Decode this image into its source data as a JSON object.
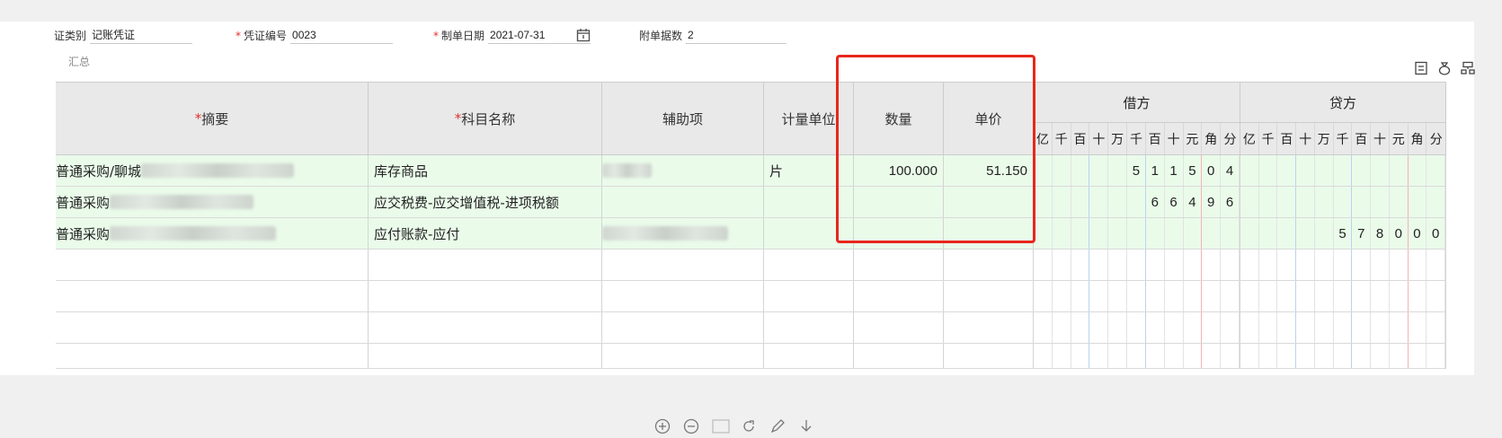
{
  "header": {
    "voucher_type_label": "证类别",
    "voucher_type_value": "记账凭证",
    "voucher_no_label": "凭证编号",
    "voucher_no_value": "0023",
    "date_label": "制单日期",
    "date_value": "2021-07-31",
    "attachments_label": "附单据数",
    "attachments_value": "2",
    "required_mark": "*"
  },
  "summary_label": "汇总",
  "columns": {
    "summary": "摘要",
    "account": "科目名称",
    "auxiliary": "辅助项",
    "unit": "计量单位",
    "quantity": "数量",
    "unit_price": "单价",
    "debit": "借方",
    "credit": "贷方",
    "digit_places": [
      "亿",
      "千",
      "百",
      "十",
      "万",
      "千",
      "百",
      "十",
      "元",
      "角",
      "分"
    ]
  },
  "rows": [
    {
      "summary": "普通采购/聊城",
      "account": "库存商品",
      "unit": "片",
      "quantity": "100.000",
      "unit_price": "51.150",
      "debit_digits": [
        "",
        "",
        "",
        "",
        "",
        "5",
        "1",
        "1",
        "5",
        "0",
        "4"
      ],
      "credit_digits": [
        "",
        "",
        "",
        "",
        "",
        "",
        "",
        "",
        "",
        "",
        ""
      ]
    },
    {
      "summary": "普通采购",
      "account": "应交税费-应交增值税-进项税额",
      "unit": "",
      "quantity": "",
      "unit_price": "",
      "debit_digits": [
        "",
        "",
        "",
        "",
        "",
        "",
        "6",
        "6",
        "4",
        "9",
        "6"
      ],
      "credit_digits": [
        "",
        "",
        "",
        "",
        "",
        "",
        "",
        "",
        "",
        "",
        ""
      ]
    },
    {
      "summary": "普通采购",
      "account": "应付账款-应付",
      "unit": "",
      "quantity": "",
      "unit_price": "",
      "debit_digits": [
        "",
        "",
        "",
        "",
        "",
        "",
        "",
        "",
        "",
        "",
        ""
      ],
      "credit_digits": [
        "",
        "",
        "",
        "",
        "",
        "5",
        "7",
        "8",
        "0",
        "0",
        "0"
      ]
    }
  ],
  "empty_rows": 4,
  "accent_red": "#e8261c",
  "row_fill": "#eafbea"
}
